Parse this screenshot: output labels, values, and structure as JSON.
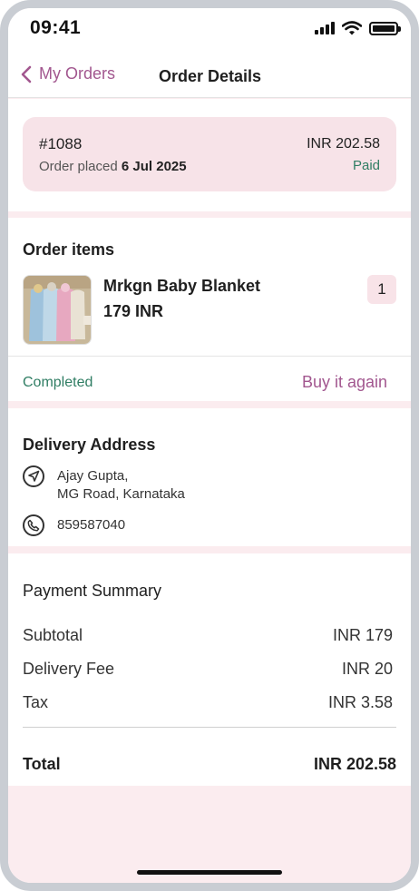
{
  "status_bar": {
    "time": "09:41"
  },
  "header": {
    "back_label": "My Orders",
    "title": "Order Details"
  },
  "order": {
    "number": "#1088",
    "total": "INR 202.58",
    "placed_label": "Order placed",
    "placed_date": "6 Jul 2025",
    "payment_status": "Paid"
  },
  "items_section": {
    "title": "Order items",
    "items": [
      {
        "name": "Mrkgn Baby Blanket",
        "price": "179 INR",
        "quantity": "1"
      }
    ],
    "status": "Completed",
    "buy_again_label": "Buy it again"
  },
  "delivery": {
    "title": "Delivery Address",
    "address_line1": "Ajay Gupta,",
    "address_line2": "MG Road, Karnataka",
    "phone": "859587040"
  },
  "payment": {
    "title": "Payment Summary",
    "subtotal_label": "Subtotal",
    "subtotal_value": "INR 179",
    "delivery_label": "Delivery Fee",
    "delivery_value": "INR 20",
    "tax_label": "Tax",
    "tax_value": "INR 3.58",
    "total_label": "Total",
    "total_value": "INR 202.58"
  },
  "colors": {
    "accent": "#a2578f",
    "success": "#2f7d63",
    "card_bg": "#f7e3e8",
    "page_bg": "#fbecef"
  },
  "icons": {
    "back": "chevron-left-icon",
    "location": "navigation-arrow-icon",
    "phone": "phone-icon"
  }
}
